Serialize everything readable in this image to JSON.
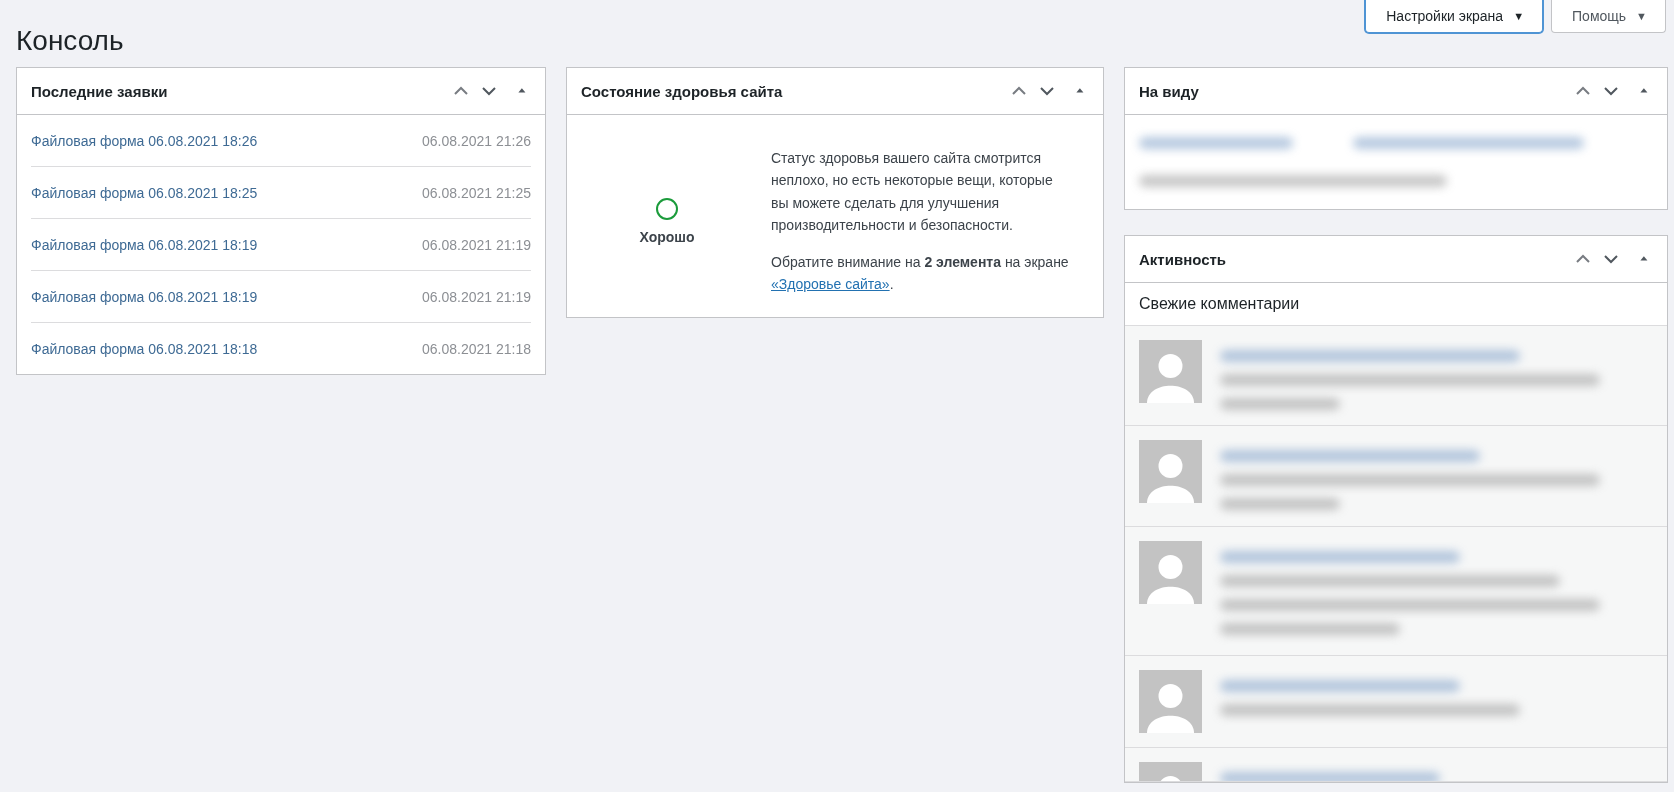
{
  "screen_options": [
    {
      "label": "Настройки экрана",
      "caret": "▼",
      "focused": true
    },
    {
      "label": "Помощь",
      "caret": "▼",
      "focused": false
    }
  ],
  "page_title": "Консоль",
  "recent_entries": {
    "title": "Последние заявки",
    "rows": [
      {
        "link": "Файловая форма 06.08.2021 18:26",
        "date": "06.08.2021 21:26"
      },
      {
        "link": "Файловая форма 06.08.2021 18:25",
        "date": "06.08.2021 21:25"
      },
      {
        "link": "Файловая форма 06.08.2021 18:19",
        "date": "06.08.2021 21:19"
      },
      {
        "link": "Файловая форма 06.08.2021 18:19",
        "date": "06.08.2021 21:19"
      },
      {
        "link": "Файловая форма 06.08.2021 18:18",
        "date": "06.08.2021 21:18"
      }
    ]
  },
  "site_health": {
    "title": "Состояние здоровья сайта",
    "status": "Хорошо",
    "description": "Статус здоровья вашего сайта смотрится неплохо, но есть некоторые вещи, которые вы можете сделать для улучшения производительности и безопасности.",
    "notice": "Обратите внимание на **2 элемента** на экране",
    "link": "«Здоровье сайта»",
    "link_after": "."
  },
  "at_a_glance": {
    "title": "На виду"
  },
  "activity": {
    "title": "Активность",
    "subtitle": "Свежие комментарии"
  }
}
